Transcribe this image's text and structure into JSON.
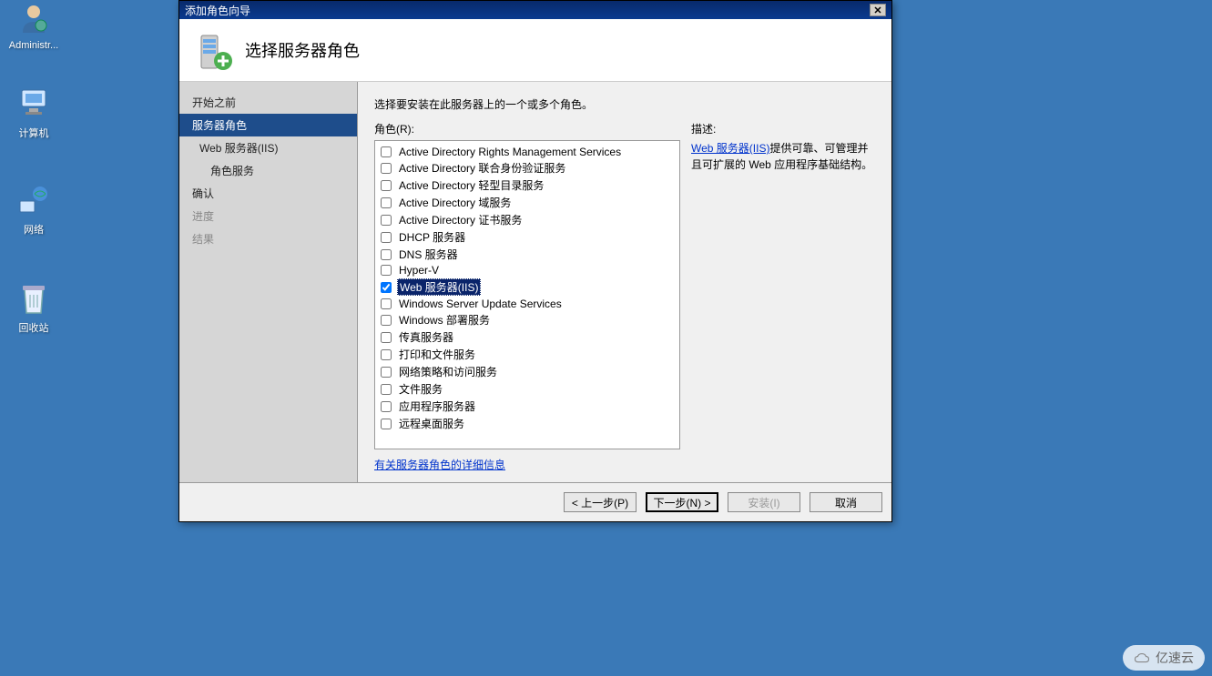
{
  "desktop": {
    "icons": [
      {
        "id": "admin",
        "label": "Administr..."
      },
      {
        "id": "computer",
        "label": "计算机"
      },
      {
        "id": "network",
        "label": "网络"
      },
      {
        "id": "recycle",
        "label": "回收站"
      }
    ]
  },
  "dialog": {
    "title": "添加角色向导",
    "header_title": "选择服务器角色",
    "sidebar": [
      {
        "label": "开始之前",
        "indent": 0,
        "active": false,
        "dim": false
      },
      {
        "label": "服务器角色",
        "indent": 0,
        "active": true,
        "dim": false
      },
      {
        "label": "Web 服务器(IIS)",
        "indent": 1,
        "active": false,
        "dim": false
      },
      {
        "label": "角色服务",
        "indent": 2,
        "active": false,
        "dim": false
      },
      {
        "label": "确认",
        "indent": 0,
        "active": false,
        "dim": false
      },
      {
        "label": "进度",
        "indent": 0,
        "active": false,
        "dim": true
      },
      {
        "label": "结果",
        "indent": 0,
        "active": false,
        "dim": true
      }
    ],
    "instruction": "选择要安装在此服务器上的一个或多个角色。",
    "roles_label": "角色(R):",
    "roles": [
      {
        "label": "Active Directory Rights Management Services",
        "checked": false,
        "selected": false
      },
      {
        "label": "Active Directory 联合身份验证服务",
        "checked": false,
        "selected": false
      },
      {
        "label": "Active Directory 轻型目录服务",
        "checked": false,
        "selected": false
      },
      {
        "label": "Active Directory 域服务",
        "checked": false,
        "selected": false
      },
      {
        "label": "Active Directory 证书服务",
        "checked": false,
        "selected": false
      },
      {
        "label": "DHCP 服务器",
        "checked": false,
        "selected": false
      },
      {
        "label": "DNS 服务器",
        "checked": false,
        "selected": false
      },
      {
        "label": "Hyper-V",
        "checked": false,
        "selected": false
      },
      {
        "label": "Web 服务器(IIS)",
        "checked": true,
        "selected": true
      },
      {
        "label": "Windows Server Update Services",
        "checked": false,
        "selected": false
      },
      {
        "label": "Windows 部署服务",
        "checked": false,
        "selected": false
      },
      {
        "label": "传真服务器",
        "checked": false,
        "selected": false
      },
      {
        "label": "打印和文件服务",
        "checked": false,
        "selected": false
      },
      {
        "label": "网络策略和访问服务",
        "checked": false,
        "selected": false
      },
      {
        "label": "文件服务",
        "checked": false,
        "selected": false
      },
      {
        "label": "应用程序服务器",
        "checked": false,
        "selected": false
      },
      {
        "label": "远程桌面服务",
        "checked": false,
        "selected": false
      }
    ],
    "more_info_link": "有关服务器角色的详细信息",
    "desc_label": "描述:",
    "desc_link_text": "Web 服务器(IIS)",
    "desc_body": "提供可靠、可管理并且可扩展的 Web 应用程序基础结构。",
    "buttons": {
      "prev": "< 上一步(P)",
      "next": "下一步(N) >",
      "install": "安装(I)",
      "cancel": "取消"
    }
  },
  "watermark": "亿速云"
}
